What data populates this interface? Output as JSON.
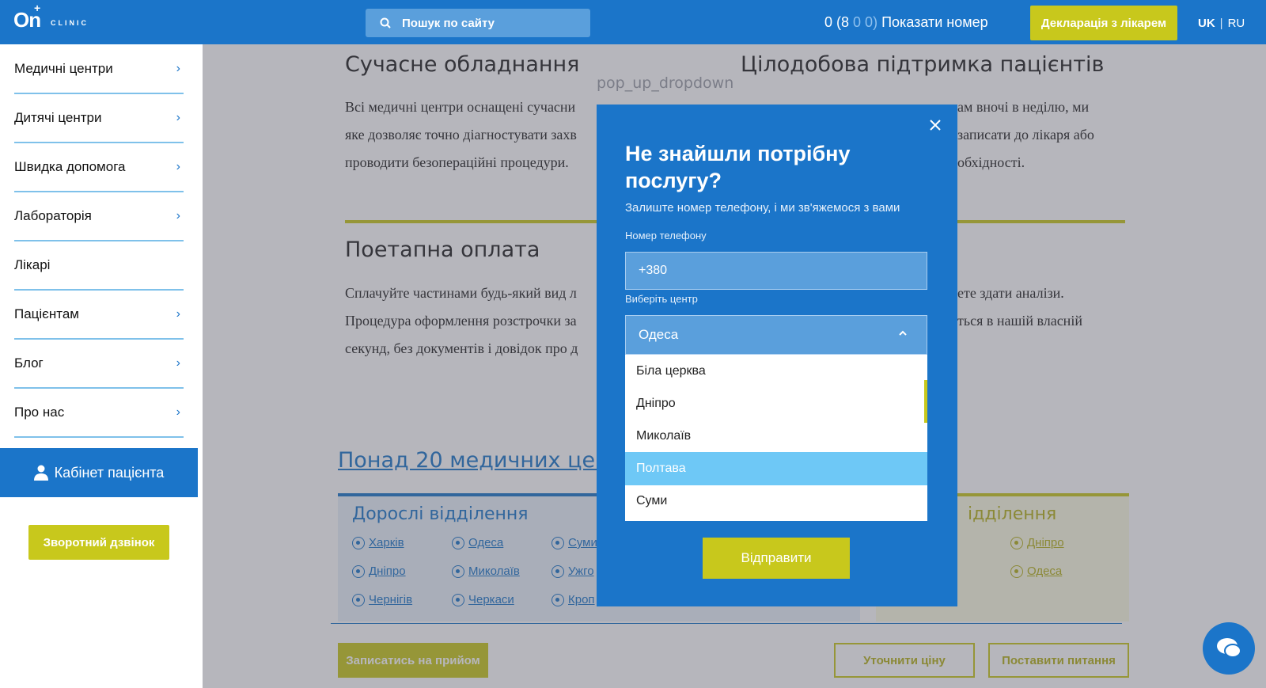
{
  "header": {
    "logo_text": "On",
    "logo_sub": "CLINIC",
    "search_label": "Пошук по сайту",
    "phone_prefix": "0 (8",
    "phone_dim": "0 0)",
    "phone_action": "Показати номер",
    "declaration_button": "Декларація з лікарем",
    "lang_uk": "UK",
    "lang_sep": "|",
    "lang_ru": "RU"
  },
  "sidebar": {
    "items": [
      {
        "label": "Медичні центри",
        "has_arrow": true
      },
      {
        "label": "Дитячі центри",
        "has_arrow": true
      },
      {
        "label": "Швидка допомога",
        "has_arrow": true
      },
      {
        "label": "Лабораторія",
        "has_arrow": true
      },
      {
        "label": "Лікарі",
        "has_arrow": false
      },
      {
        "label": "Пацієнтам",
        "has_arrow": true
      },
      {
        "label": "Блог",
        "has_arrow": true
      },
      {
        "label": "Про нас",
        "has_arrow": true
      }
    ],
    "cabinet_label": "Кабінет пацієнта",
    "callback_label": "Зворотний дзвінок"
  },
  "main": {
    "section1": {
      "title": "Сучасне обладнання",
      "lines": [
        "Всі медичні центри оснащені сучасни",
        "яке дозволяє точно діагностувати захв",
        "проводити безопераційні процедури."
      ]
    },
    "section2": {
      "title": "Цілодобова підтримка пацієнтів",
      "lines": [
        "ам вночі в неділю, ми",
        "записати до лікаря або",
        "обхідності."
      ]
    },
    "section3": {
      "title": "Поетапна оплата",
      "lines": [
        "Сплачуйте частинами будь-який вид л",
        "Процедура оформлення розстрочки за",
        "секунд, без документів і довідок про д"
      ]
    },
    "section4": {
      "lines": [
        "ете здати аналізи.",
        "ться в нашій власній"
      ]
    },
    "centers_link": "Понад 20 медичних центр",
    "adult_title": "Дорослі відділення",
    "adult_cities": [
      "Харків",
      "Одеса",
      "Суми",
      "Дніпро",
      "Миколаїв",
      "Ужго",
      "Чернігів",
      "Черкаси",
      "Кроп"
    ],
    "child_title": "ідділення",
    "child_cities": [
      "Дніпро",
      "Одеса"
    ],
    "book_button": "Записатись на прийом",
    "price_button": "Уточнити ціну",
    "question_button": "Поставити питання"
  },
  "popup_label": "pop_up_dropdown",
  "modal": {
    "title": "Не знайшли потрібну послугу?",
    "subtitle": "Залиште номер телефону, і ми зв'яжемося з вами",
    "phone_label": "Номер телефону",
    "phone_value": "+380",
    "center_label": "Виберіть центр",
    "selected_center": "Одеса",
    "options": [
      "Біла церква",
      "Дніпро",
      "Миколаїв",
      "Полтава",
      "Суми"
    ],
    "highlighted_option": "Полтава",
    "submit_label": "Відправити"
  },
  "colors": {
    "primary": "#1b75c9",
    "accent": "#c8c81c",
    "highlight": "#6ec8f6"
  }
}
